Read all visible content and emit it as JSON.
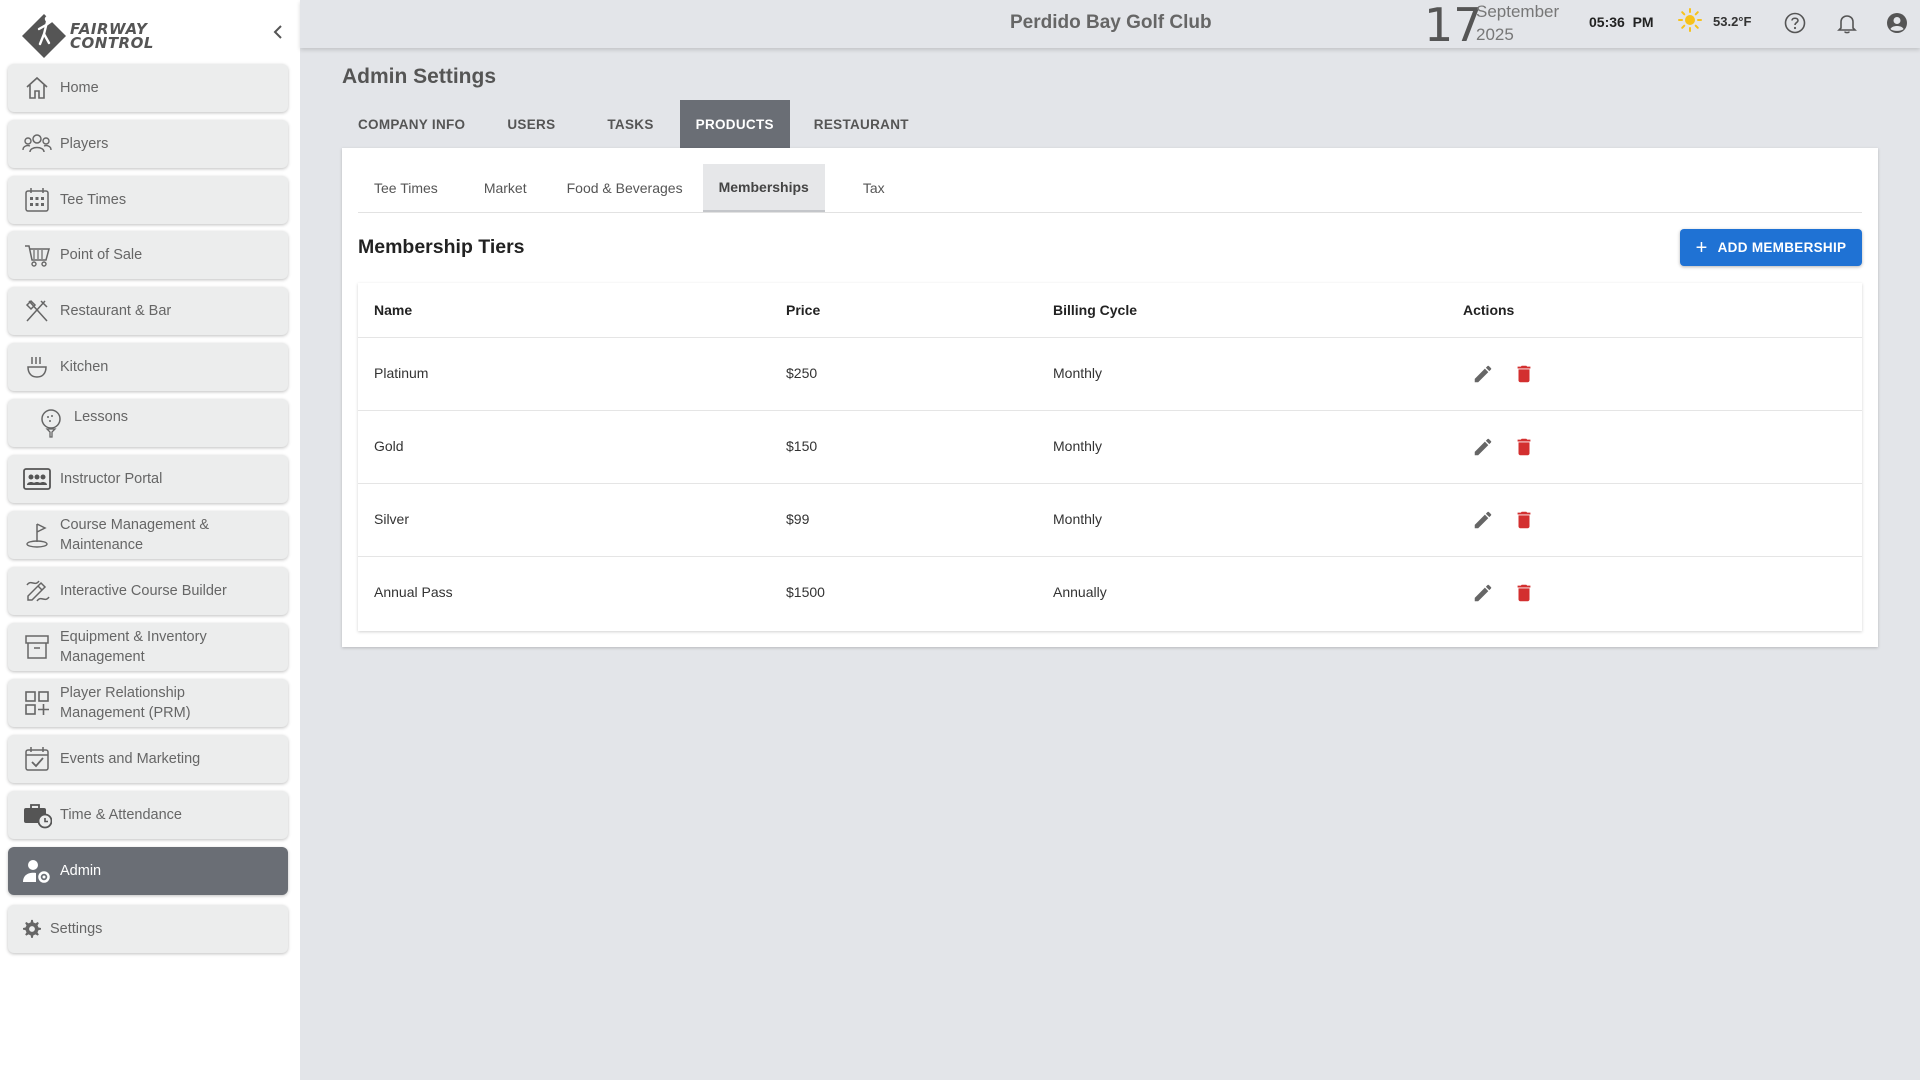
{
  "brand": {
    "line1": "FAIRWAY",
    "line2": "CONTROL"
  },
  "sidebar": {
    "items": [
      {
        "label": "Home",
        "icon": "home-icon"
      },
      {
        "label": "Players",
        "icon": "players-icon"
      },
      {
        "label": "Tee Times",
        "icon": "calendar-grid-icon"
      },
      {
        "label": "Point of Sale",
        "icon": "cart-icon"
      },
      {
        "label": "Restaurant & Bar",
        "icon": "utensils-icon"
      },
      {
        "label": "Kitchen",
        "icon": "kitchen-icon"
      },
      {
        "label": "Lessons",
        "icon": "golf-ball-tee-icon"
      },
      {
        "label": "Instructor Portal",
        "icon": "instructor-icon"
      },
      {
        "label": "Course Management & Maintenance",
        "icon": "flag-icon"
      },
      {
        "label": "Interactive Course Builder",
        "icon": "course-builder-icon"
      },
      {
        "label": "Equipment & Inventory Management",
        "icon": "inventory-icon"
      },
      {
        "label": "Player Relationship Management (PRM)",
        "icon": "widgets-icon"
      },
      {
        "label": "Events and Marketing",
        "icon": "event-check-icon"
      },
      {
        "label": "Time & Attendance",
        "icon": "briefcase-clock-icon"
      },
      {
        "label": "Admin",
        "icon": "admin-user-gear-icon"
      },
      {
        "label": "Settings",
        "icon": "gear-icon"
      }
    ]
  },
  "header": {
    "club": "Perdido Bay Golf Club",
    "day": "17",
    "month": "September",
    "year": "2025",
    "time": "05:36  PM",
    "temperature": "53.2°F",
    "weather_icon": "sun-icon"
  },
  "page": {
    "title": "Admin Settings",
    "tabs": [
      "COMPANY INFO",
      "USERS",
      "TASKS",
      "PRODUCTS",
      "RESTAURANT"
    ],
    "active_tab": "PRODUCTS",
    "sub_tabs": [
      "Tee Times",
      "Market",
      "Food & Beverages",
      "Memberships",
      "Tax"
    ],
    "active_sub_tab": "Memberships",
    "section_title": "Membership Tiers",
    "add_button": "ADD MEMBERSHIP"
  },
  "table": {
    "headers": [
      "Name",
      "Price",
      "Billing Cycle",
      "Actions"
    ],
    "rows": [
      {
        "name": "Platinum",
        "price": "$250",
        "cycle": "Monthly"
      },
      {
        "name": "Gold",
        "price": "$150",
        "cycle": "Monthly"
      },
      {
        "name": "Silver",
        "price": "$99",
        "cycle": "Monthly"
      },
      {
        "name": "Annual Pass",
        "price": "$1500",
        "cycle": "Annually"
      }
    ]
  },
  "colors": {
    "accent": "#1f72d4",
    "active_nav": "#6a6e75",
    "delete": "#d32f2f",
    "background": "#e3e5e9"
  }
}
